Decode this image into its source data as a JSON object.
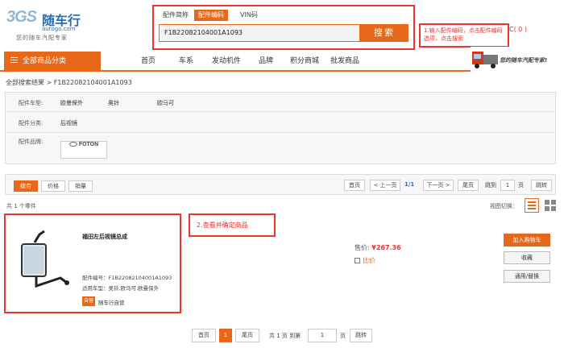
{
  "logo": {
    "mark": "3GS",
    "name": "随车行",
    "domain": "autogo.com",
    "tagline": "您的随车汽配专家"
  },
  "search": {
    "tabs": [
      "配件简称",
      "配件编码",
      "VIN码"
    ],
    "active_tab": 1,
    "value": "F1B22082104001A1093",
    "button": "搜索"
  },
  "note1": "1.输入配件编码，点击配件编码选项，点击搜索",
  "cart": {
    "label": "C",
    "count": "( 0 )"
  },
  "nav": {
    "category": "全部商品分类",
    "items": [
      "首页",
      "车系",
      "发动机件",
      "品牌",
      "积分商城",
      "批发商品"
    ],
    "slogan": "您的随车汽配专家!"
  },
  "breadcrumb": "全部搜索结果 > F1B22082104001A1093",
  "filters": {
    "model_label": "配件车型:",
    "models": [
      "欧曼保外",
      "奥铃",
      "欧马可"
    ],
    "class_label": "配件分类:",
    "class_value": "后视镜",
    "brand_label": "配件品牌:",
    "brand_logo": "FOTON"
  },
  "sort": {
    "tabs": [
      "综合",
      "价格",
      "销量"
    ],
    "active": 0
  },
  "pager_top": {
    "first": "首页",
    "prev": "< 上一页",
    "page": "1/1",
    "next": "下一页 >",
    "last": "尾页",
    "goto": "跳到",
    "page_input": "1",
    "page_unit": "页",
    "jump": "跳转"
  },
  "result_count": "共 1 个零件",
  "view_label": "视图切换：",
  "note2": "2.查看并确定商品",
  "product": {
    "title": "福田左后视镜总成",
    "code": "配件编号：F1B22082104001A1093",
    "fit": "适用车型：奥铃,欧马可,欧曼保外",
    "badge": "自营",
    "self_text": "随车行自营",
    "price_label": "售价: ",
    "price": "¥267.36",
    "compare": "比价"
  },
  "actions": [
    "加入购物车",
    "收藏",
    "通用/替换"
  ],
  "pager_bottom": {
    "first": "首页",
    "page": "1",
    "last": "尾页",
    "total": "共 1 页 到第",
    "page_input": "1",
    "page_unit": "页",
    "jump": "跳转"
  },
  "colors": {
    "accent": "#e8681a",
    "highlight": "#e33333",
    "link": "#2a6db0"
  }
}
